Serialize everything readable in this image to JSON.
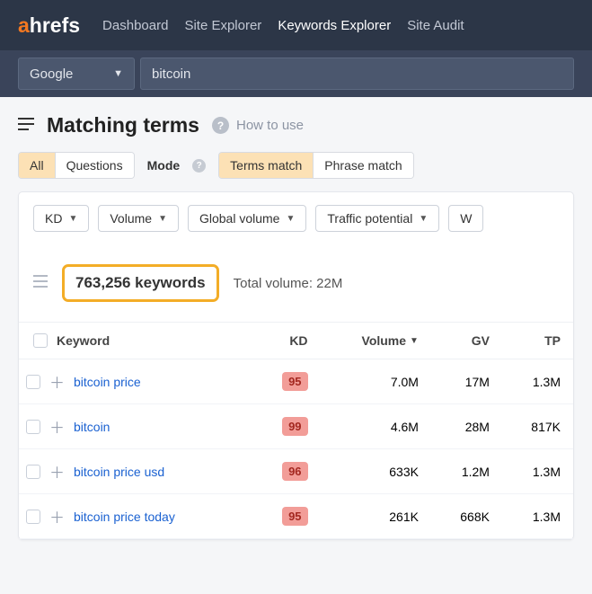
{
  "brand": {
    "pre": "a",
    "rest": "hrefs"
  },
  "nav": {
    "items": [
      "Dashboard",
      "Site Explorer",
      "Keywords Explorer",
      "Site Audit"
    ],
    "active": 2
  },
  "search": {
    "engine": "Google",
    "query": "bitcoin"
  },
  "page": {
    "title": "Matching terms",
    "help": "How to use"
  },
  "type_tabs": {
    "items": [
      "All",
      "Questions"
    ],
    "active": 0
  },
  "mode_label": "Mode",
  "mode_tabs": {
    "items": [
      "Terms match",
      "Phrase match"
    ],
    "active": 0
  },
  "filters": [
    "KD",
    "Volume",
    "Global volume",
    "Traffic potential",
    "W"
  ],
  "summary": {
    "count": "763,256 keywords",
    "total_volume": "Total volume: 22M"
  },
  "columns": {
    "keyword": "Keyword",
    "kd": "KD",
    "volume": "Volume",
    "gv": "GV",
    "tp": "TP"
  },
  "rows": [
    {
      "kw": "bitcoin price",
      "kd": "95",
      "vol": "7.0M",
      "gv": "17M",
      "tp": "1.3M"
    },
    {
      "kw": "bitcoin",
      "kd": "99",
      "vol": "4.6M",
      "gv": "28M",
      "tp": "817K"
    },
    {
      "kw": "bitcoin price usd",
      "kd": "96",
      "vol": "633K",
      "gv": "1.2M",
      "tp": "1.3M"
    },
    {
      "kw": "bitcoin price today",
      "kd": "95",
      "vol": "261K",
      "gv": "668K",
      "tp": "1.3M"
    }
  ]
}
